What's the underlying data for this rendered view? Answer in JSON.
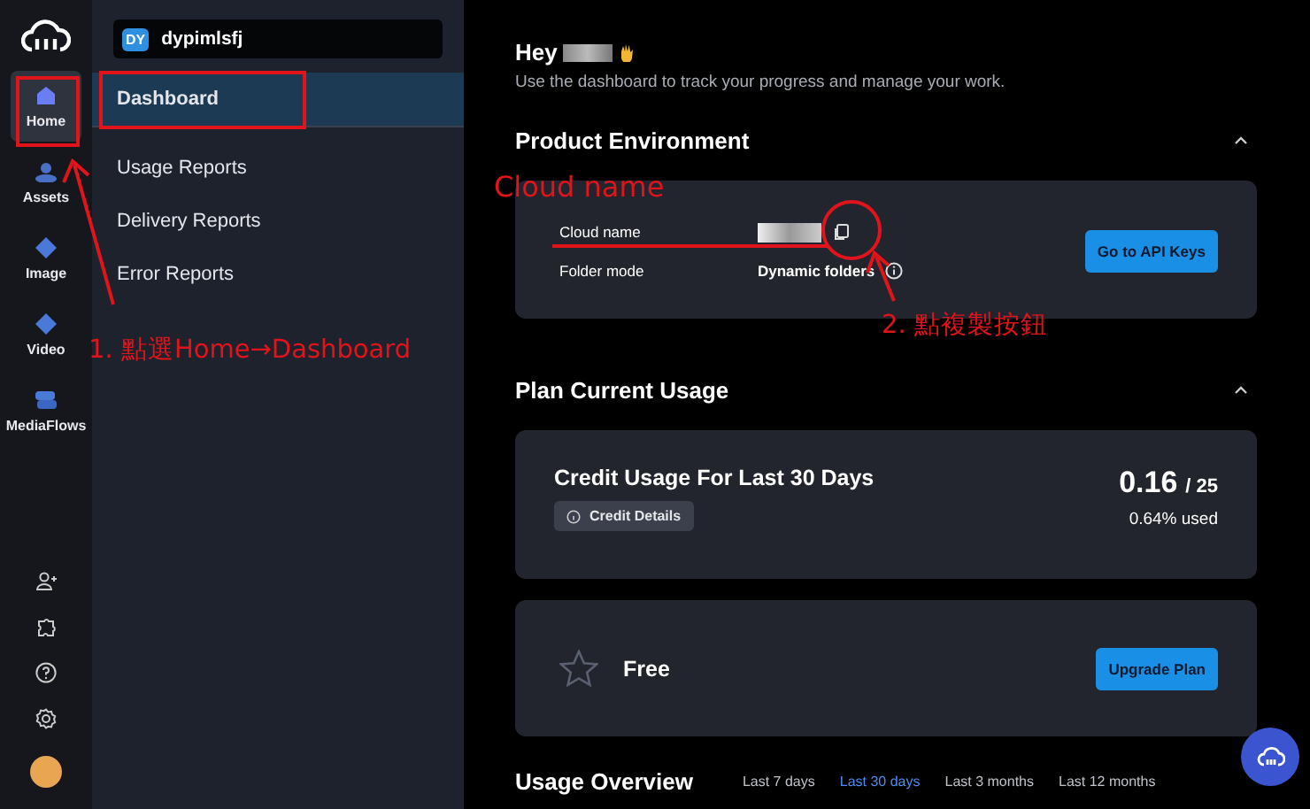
{
  "workspace": {
    "badge": "DY",
    "name": "dypimlsfj"
  },
  "rail": {
    "items": [
      {
        "label": "Home",
        "kind": "home",
        "selected": true
      },
      {
        "label": "Assets",
        "kind": "assets",
        "selected": false
      },
      {
        "label": "Image",
        "kind": "image",
        "selected": false
      },
      {
        "label": "Video",
        "kind": "video",
        "selected": false
      },
      {
        "label": "MediaFlows",
        "kind": "flows",
        "selected": false
      }
    ]
  },
  "subnav": {
    "items": [
      {
        "label": "Dashboard",
        "selected": true
      },
      {
        "label": "Usage Reports",
        "selected": false
      },
      {
        "label": "Delivery Reports",
        "selected": false
      },
      {
        "label": "Error Reports",
        "selected": false
      }
    ]
  },
  "greeting": {
    "text": "Hey",
    "subtitle": "Use the dashboard to track your progress and manage your work."
  },
  "product_environment": {
    "title": "Product Environment",
    "expanded": true,
    "rows": [
      {
        "label": "Cloud name",
        "kind": "copy"
      },
      {
        "label": "Folder mode",
        "value": "Dynamic folders",
        "kind": "info"
      }
    ],
    "button": "Go to API Keys"
  },
  "plan_usage": {
    "title": "Plan Current Usage",
    "expanded": true,
    "credit": {
      "title": "Credit Usage For Last 30 Days",
      "details_button": "Credit Details",
      "used": "0.16",
      "total": "/ 25",
      "percent": "0.64% used"
    },
    "plan": {
      "name": "Free",
      "button": "Upgrade Plan"
    }
  },
  "usage_overview": {
    "title": "Usage Overview",
    "ranges": [
      {
        "label": "Last 7 days",
        "selected": false
      },
      {
        "label": "Last 30 days",
        "selected": true
      },
      {
        "label": "Last 3 months",
        "selected": false
      },
      {
        "label": "Last 12 months",
        "selected": false
      }
    ]
  },
  "annotations": [
    {
      "kind": "label",
      "text": "Cloud name"
    },
    {
      "kind": "step",
      "text": "1. 點選Home→Dashboard"
    },
    {
      "kind": "step",
      "text": "2. 點複製按鈕"
    }
  ]
}
